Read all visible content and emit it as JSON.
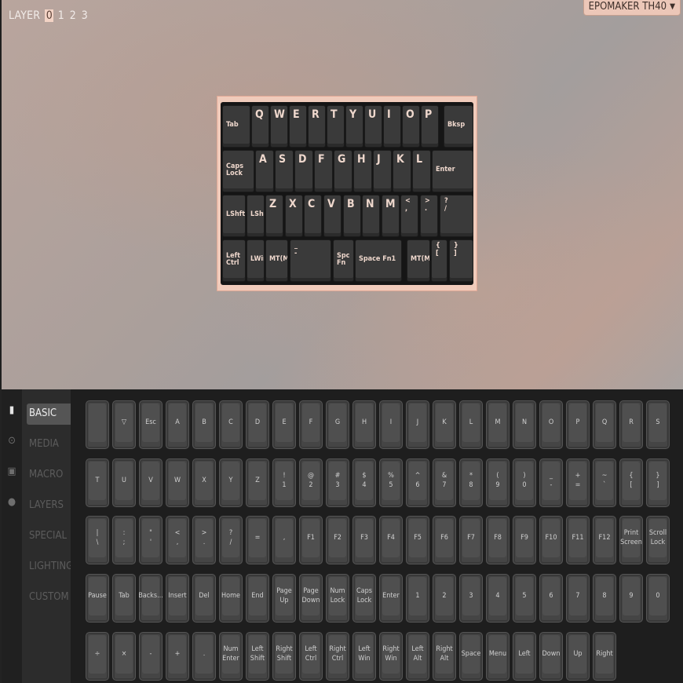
{
  "layer": {
    "label": "LAYER",
    "layers": [
      "0",
      "1",
      "2",
      "3"
    ],
    "active": "0"
  },
  "keyboard_select": {
    "value": "EPOMAKER TH40",
    "chevron": "chevron-down-icon"
  },
  "board_rows": [
    [
      {
        "kind": "small",
        "label": "Tab"
      },
      {
        "kind": "big",
        "label": "Q"
      },
      {
        "kind": "big",
        "label": "W"
      },
      {
        "kind": "big",
        "label": "E"
      },
      {
        "kind": "big",
        "label": "R"
      },
      {
        "kind": "big",
        "label": "T"
      },
      {
        "kind": "big",
        "label": "Y"
      },
      {
        "kind": "big",
        "label": "U"
      },
      {
        "kind": "big",
        "label": "I"
      },
      {
        "kind": "big",
        "label": "O"
      },
      {
        "kind": "big",
        "label": "P"
      },
      {
        "kind": "small",
        "label": "Bksp"
      }
    ],
    [
      {
        "kind": "small",
        "label": "Caps Lock"
      },
      {
        "kind": "big",
        "label": "A"
      },
      {
        "kind": "big",
        "label": "S"
      },
      {
        "kind": "big",
        "label": "D"
      },
      {
        "kind": "big",
        "label": "F"
      },
      {
        "kind": "big",
        "label": "G"
      },
      {
        "kind": "big",
        "label": "H"
      },
      {
        "kind": "big",
        "label": "J"
      },
      {
        "kind": "big",
        "label": "K"
      },
      {
        "kind": "big",
        "label": "L"
      },
      {
        "kind": "small",
        "label": "Enter"
      }
    ],
    [
      {
        "kind": "small",
        "label": "LShft"
      },
      {
        "kind": "small",
        "label": "LShft"
      },
      {
        "kind": "big",
        "label": "Z"
      },
      {
        "kind": "big",
        "label": "X"
      },
      {
        "kind": "big",
        "label": "C"
      },
      {
        "kind": "big",
        "label": "V"
      },
      {
        "kind": "big",
        "label": "B"
      },
      {
        "kind": "big",
        "label": "N"
      },
      {
        "kind": "big",
        "label": "M"
      },
      {
        "kind": "dual",
        "top": "<",
        "bottom": ","
      },
      {
        "kind": "dual",
        "top": ">",
        "bottom": "."
      },
      {
        "kind": "dual",
        "top": "?",
        "bottom": "/"
      }
    ],
    [
      {
        "kind": "small",
        "label": "Left Ctrl"
      },
      {
        "kind": "small",
        "label": "LWin"
      },
      {
        "kind": "small",
        "label": "MT(MOD"
      },
      {
        "kind": "dual",
        "top": "_",
        "bottom": "-"
      },
      {
        "kind": "small",
        "label": "Spc Fn"
      },
      {
        "kind": "small",
        "label": "Space Fn1"
      },
      {
        "kind": "small",
        "label": "MT(MOD"
      },
      {
        "kind": "dual",
        "top": "{",
        "bottom": "["
      },
      {
        "kind": "dual",
        "top": "}",
        "bottom": "]"
      }
    ]
  ],
  "side_icons": [
    "keyboard-icon",
    "gear-icon",
    "save-icon",
    "lightbulb-icon"
  ],
  "categories": [
    "BASIC",
    "MEDIA",
    "MACRO",
    "LAYERS",
    "SPECIAL",
    "LIGHTING",
    "CUSTOM"
  ],
  "active_category": "BASIC",
  "key_rows": [
    [
      [
        ""
      ],
      [
        "▽"
      ],
      [
        "Esc"
      ],
      [
        "A"
      ],
      [
        "B"
      ],
      [
        "C"
      ],
      [
        "D"
      ],
      [
        "E"
      ],
      [
        "F"
      ],
      [
        "G"
      ],
      [
        "H"
      ],
      [
        "I"
      ],
      [
        "J"
      ],
      [
        "K"
      ],
      [
        "L"
      ],
      [
        "M"
      ],
      [
        "N"
      ],
      [
        "O"
      ],
      [
        "P"
      ],
      [
        "Q"
      ],
      [
        "R"
      ],
      [
        "S"
      ]
    ],
    [
      [
        "T"
      ],
      [
        "U"
      ],
      [
        "V"
      ],
      [
        "W"
      ],
      [
        "X"
      ],
      [
        "Y"
      ],
      [
        "Z"
      ],
      [
        "!",
        "1"
      ],
      [
        "@",
        "2"
      ],
      [
        "#",
        "3"
      ],
      [
        "$",
        "4"
      ],
      [
        "%",
        "5"
      ],
      [
        "^",
        "6"
      ],
      [
        "&",
        "7"
      ],
      [
        "*",
        "8"
      ],
      [
        "(",
        "9"
      ],
      [
        ")",
        "0"
      ],
      [
        "_",
        "-"
      ],
      [
        "+",
        "="
      ],
      [
        "~",
        "`"
      ],
      [
        "{",
        "["
      ],
      [
        "}",
        "]"
      ]
    ],
    [
      [
        "|",
        "\\"
      ],
      [
        ":",
        ";"
      ],
      [
        "\"",
        "'"
      ],
      [
        "<",
        ","
      ],
      [
        ">",
        "."
      ],
      [
        "?",
        "/"
      ],
      [
        "="
      ],
      [
        ","
      ],
      [
        "F1"
      ],
      [
        "F2"
      ],
      [
        "F3"
      ],
      [
        "F4"
      ],
      [
        "F5"
      ],
      [
        "F6"
      ],
      [
        "F7"
      ],
      [
        "F8"
      ],
      [
        "F9"
      ],
      [
        "F10"
      ],
      [
        "F11"
      ],
      [
        "F12"
      ],
      [
        "Print",
        "Screen"
      ],
      [
        "Scroll",
        "Lock"
      ]
    ],
    [
      [
        "Pause"
      ],
      [
        "Tab"
      ],
      [
        "Backs..."
      ],
      [
        "Insert"
      ],
      [
        "Del"
      ],
      [
        "Home"
      ],
      [
        "End"
      ],
      [
        "Page",
        "Up"
      ],
      [
        "Page",
        "Down"
      ],
      [
        "Num",
        "Lock"
      ],
      [
        "Caps",
        "Lock"
      ],
      [
        "Enter"
      ],
      [
        "1"
      ],
      [
        "2"
      ],
      [
        "3"
      ],
      [
        "4"
      ],
      [
        "5"
      ],
      [
        "6"
      ],
      [
        "7"
      ],
      [
        "8"
      ],
      [
        "9"
      ],
      [
        "0"
      ]
    ],
    [
      [
        "÷"
      ],
      [
        "×"
      ],
      [
        "-"
      ],
      [
        "+"
      ],
      [
        "."
      ],
      [
        "Num",
        "Enter"
      ],
      [
        "Left",
        "Shift"
      ],
      [
        "Right",
        "Shift"
      ],
      [
        "Left Ctrl"
      ],
      [
        "Right",
        "Ctrl"
      ],
      [
        "Left",
        "Win"
      ],
      [
        "Right",
        "Win"
      ],
      [
        "Left Alt"
      ],
      [
        "Right",
        "Alt"
      ],
      [
        "Space"
      ],
      [
        "Menu"
      ],
      [
        "Left"
      ],
      [
        "Down"
      ],
      [
        "Up"
      ],
      [
        "Right"
      ]
    ]
  ]
}
